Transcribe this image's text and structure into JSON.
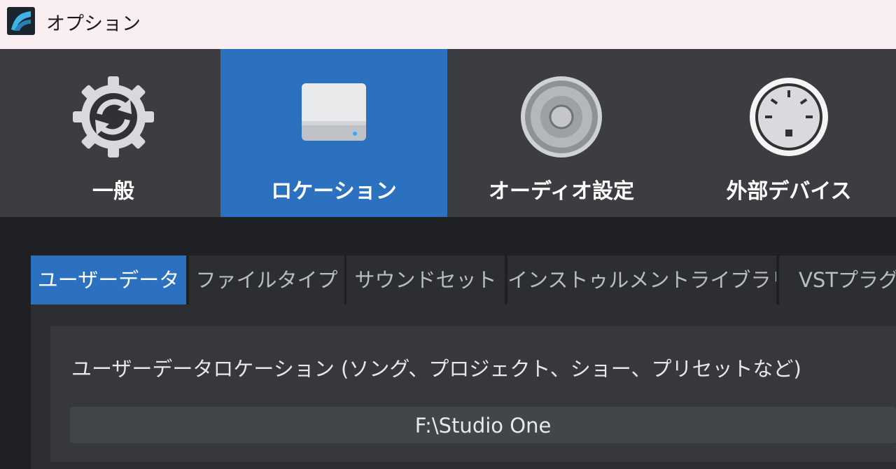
{
  "window": {
    "title": "オプション",
    "app_icon": "studio-one-app-icon"
  },
  "categories": [
    {
      "label": "一般",
      "icon": "gear-sync-icon",
      "active": false
    },
    {
      "label": "ロケーション",
      "icon": "drive-icon",
      "active": true
    },
    {
      "label": "オーディオ設定",
      "icon": "speaker-icon",
      "active": false
    },
    {
      "label": "外部デバイス",
      "icon": "midi-port-icon",
      "active": false
    }
  ],
  "tabs": [
    {
      "label": "ユーザーデータ",
      "active": true
    },
    {
      "label": "ファイルタイプ",
      "active": false
    },
    {
      "label": "サウンドセット",
      "active": false
    },
    {
      "label": "インストゥルメントライブラリ",
      "active": false
    },
    {
      "label": "VSTプラグイン",
      "active": false
    }
  ],
  "user_data": {
    "location_label": "ユーザーデータロケーション (ソング、プロジェクト、ショー、プリセットなど)",
    "path_value": "F:\\Studio One"
  },
  "colors": {
    "accent": "#2b71bf",
    "toolbar_bg": "#3b3d41",
    "titlebar_bg": "#f9eef1",
    "panel_bg": "#2c2e32"
  }
}
